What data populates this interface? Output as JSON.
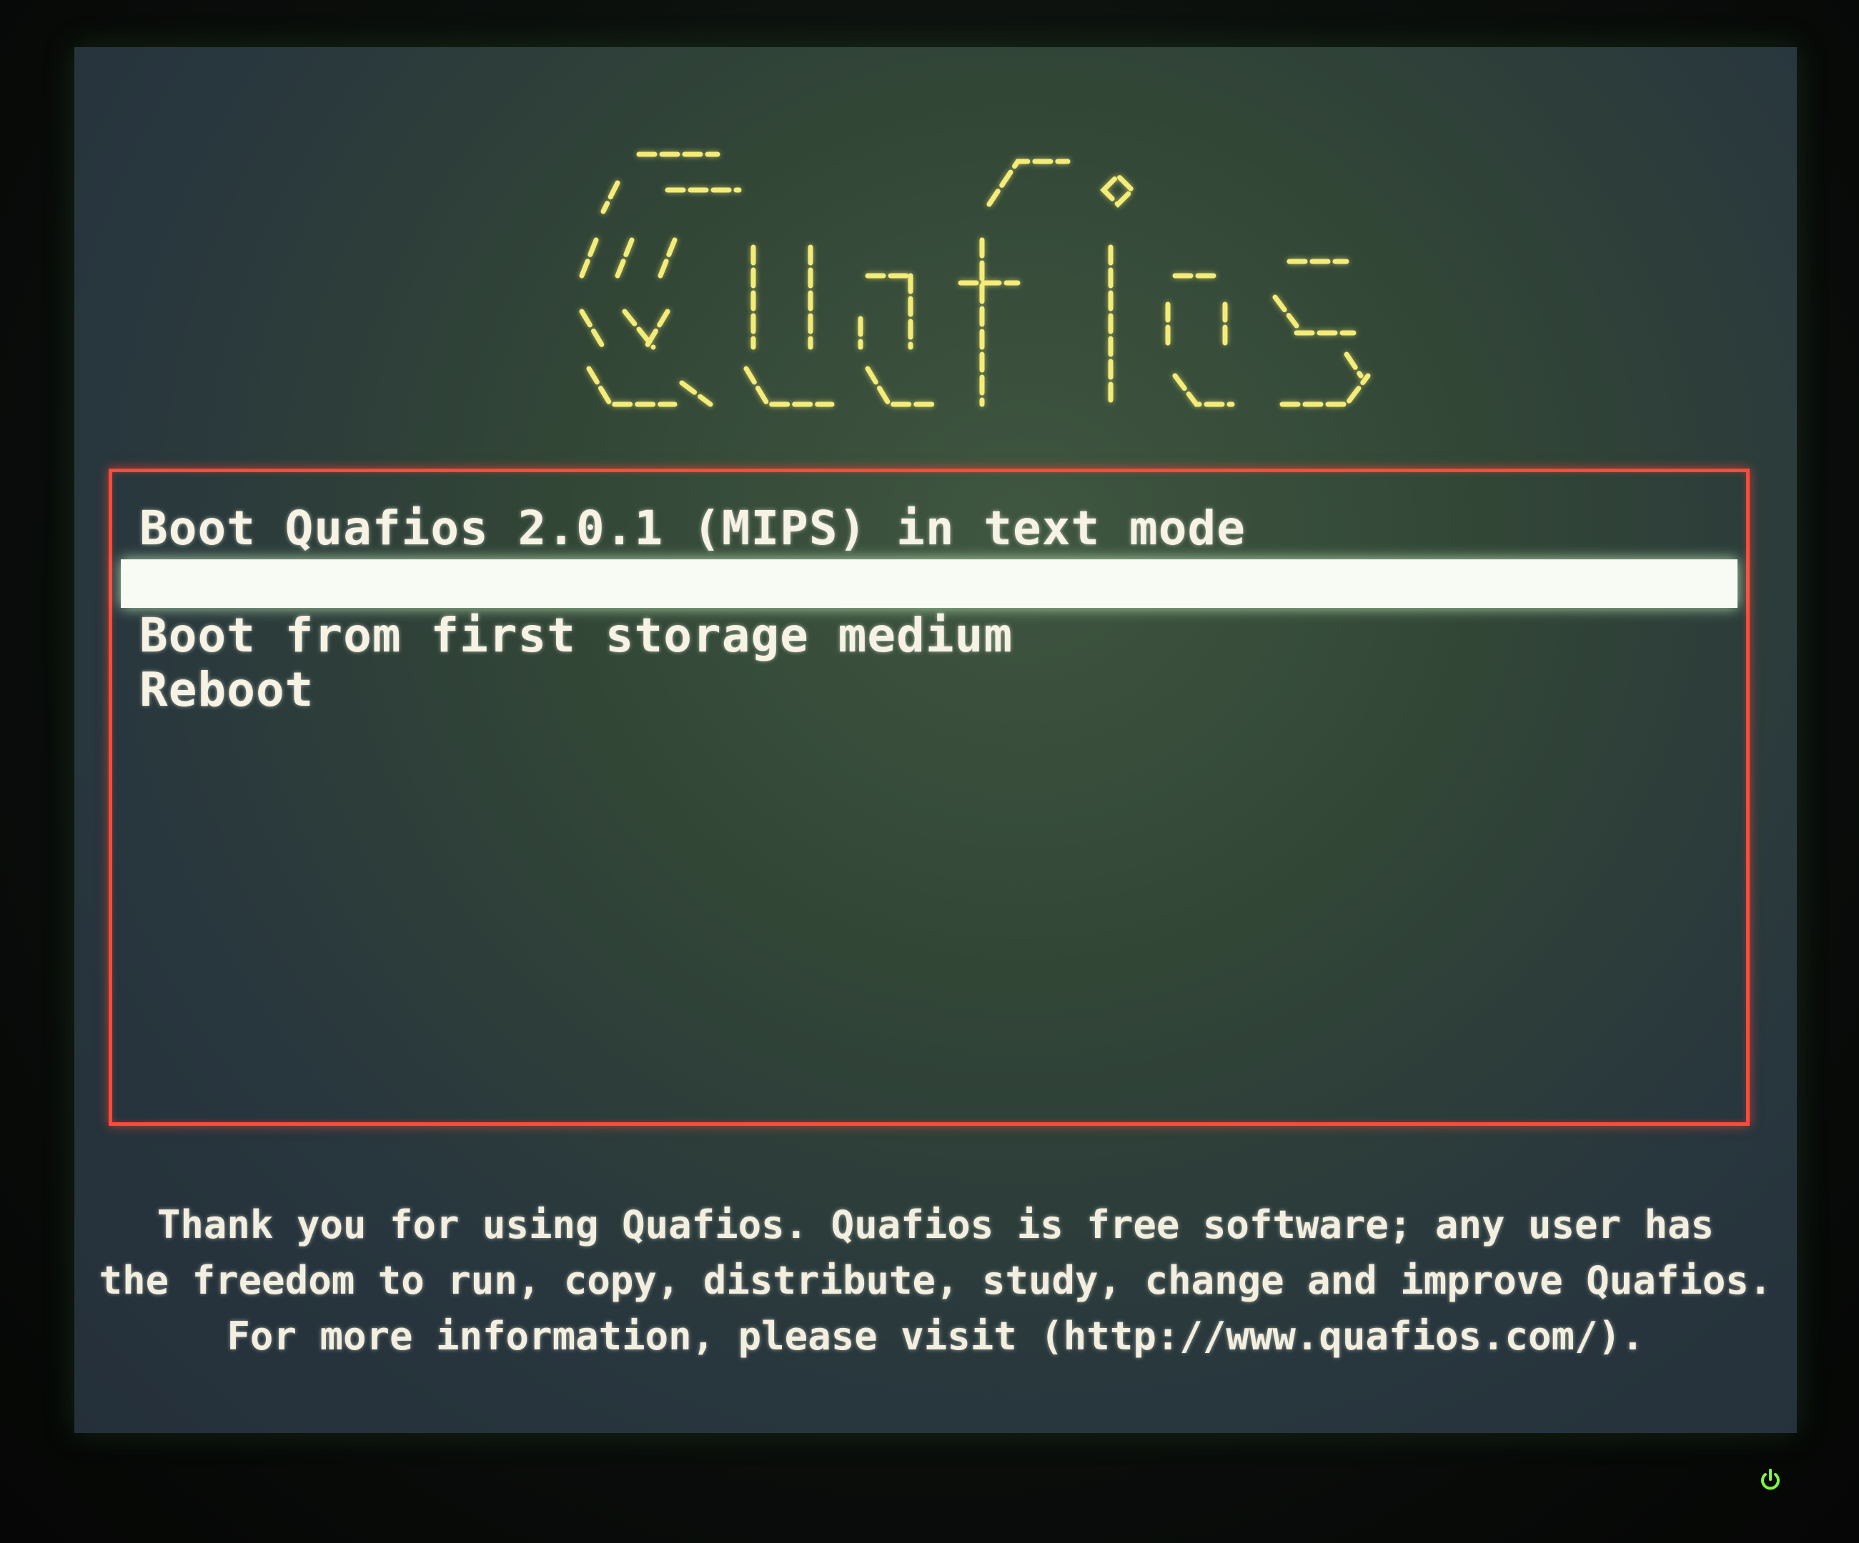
{
  "logo": {
    "text": "Quafios",
    "color": "#f4ec78"
  },
  "menu": {
    "border_color": "#ff4a3a",
    "selected_index": 1,
    "items": [
      {
        "label": "Boot Quafios 2.0.1 (MIPS) in text mode"
      },
      {
        "label": ""
      },
      {
        "label": "Boot from first storage medium"
      },
      {
        "label": "Reboot"
      }
    ]
  },
  "footer": {
    "line1": "Thank you for using Quafios. Quafios is free software; any user has",
    "line2": "the freedom to run, copy, distribute, study, change and improve Quafios.",
    "line3": "For more information, please visit (http://www.quafios.com/)."
  },
  "monitor": {
    "power_icon": "power-icon",
    "power_led_color": "#7cff3a"
  }
}
